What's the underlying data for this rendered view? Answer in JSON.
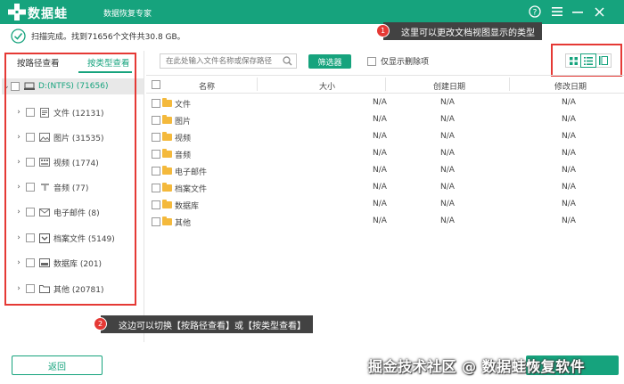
{
  "app": {
    "name": "数据蛙",
    "subtitle": "数据恢复专家",
    "title_buttons": [
      "help-icon",
      "menu-icon",
      "minimize-icon",
      "close-icon"
    ]
  },
  "status": {
    "text": "扫描完成。找到71656个文件共30.8 GB。"
  },
  "annotations": {
    "note1": {
      "badge": "1",
      "text": "这里可以更改文档视图显示的类型"
    },
    "note2": {
      "badge": "2",
      "text": "这边可以切换【按路径查看】或【按类型查看】"
    }
  },
  "left_tabs": {
    "by_path": "按路径查看",
    "by_type": "按类型查看",
    "active": "by_type"
  },
  "tree": {
    "root": {
      "label": "D:(NTFS) (71656)",
      "icon": "drive-icon"
    },
    "items": [
      {
        "label": "文件 (12131)",
        "icon": "document-icon"
      },
      {
        "label": "图片 (31535)",
        "icon": "image-icon"
      },
      {
        "label": "视频 (1774)",
        "icon": "video-icon"
      },
      {
        "label": "音频 (77)",
        "icon": "audio-icon"
      },
      {
        "label": "电子邮件 (8)",
        "icon": "email-icon"
      },
      {
        "label": "档案文件 (5149)",
        "icon": "archive-icon"
      },
      {
        "label": "数据库 (201)",
        "icon": "database-icon"
      },
      {
        "label": "其他 (20781)",
        "icon": "other-folder-icon"
      }
    ]
  },
  "toolbar": {
    "search_placeholder": "在此处输入文件名称或保存路径",
    "filter_label": "筛选器",
    "deleted_only_label": "仅显示删除项"
  },
  "view_modes": [
    "thumbnail-view-icon",
    "list-view-icon",
    "detail-view-icon"
  ],
  "active_view": "list-view-icon",
  "table": {
    "columns": [
      "名称",
      "大小",
      "创建日期",
      "修改日期"
    ],
    "rows": [
      {
        "name": "文件",
        "size": "N/A",
        "created": "N/A",
        "modified": "N/A"
      },
      {
        "name": "图片",
        "size": "N/A",
        "created": "N/A",
        "modified": "N/A"
      },
      {
        "name": "视频",
        "size": "N/A",
        "created": "N/A",
        "modified": "N/A"
      },
      {
        "name": "音频",
        "size": "N/A",
        "created": "N/A",
        "modified": "N/A"
      },
      {
        "name": "电子邮件",
        "size": "N/A",
        "created": "N/A",
        "modified": "N/A"
      },
      {
        "name": "档案文件",
        "size": "N/A",
        "created": "N/A",
        "modified": "N/A"
      },
      {
        "name": "数据库",
        "size": "N/A",
        "created": "N/A",
        "modified": "N/A"
      },
      {
        "name": "其他",
        "size": "N/A",
        "created": "N/A",
        "modified": "N/A"
      }
    ]
  },
  "footer": {
    "back_label": "返回",
    "watermark": "掘金技术社区 @ 数据蛙恢复软件"
  },
  "colors": {
    "accent": "#16a37d",
    "highlight": "#e53935",
    "folder": "#f4b93c",
    "note_bg": "#424242"
  }
}
